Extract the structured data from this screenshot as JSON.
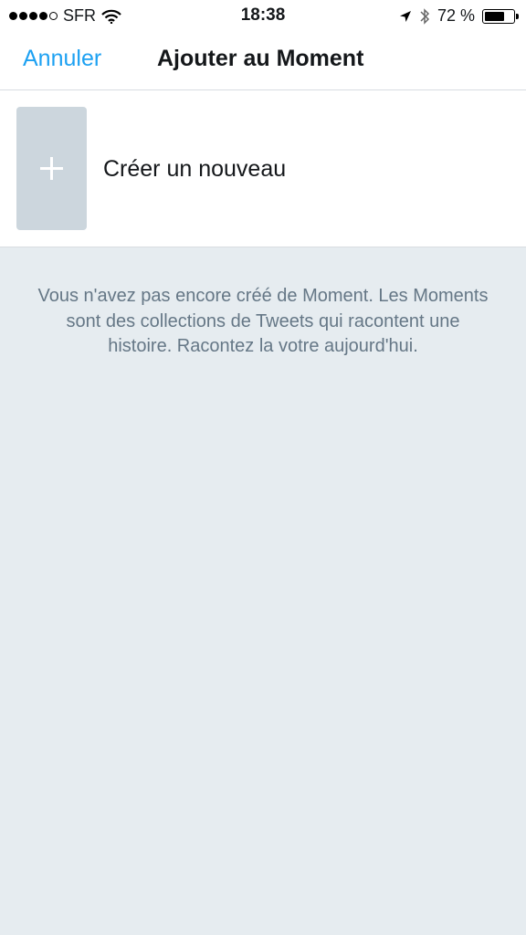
{
  "status_bar": {
    "carrier": "SFR",
    "time": "18:38",
    "battery_percent_label": "72 %",
    "battery_level": 0.72,
    "signal_bars_filled": 4,
    "signal_bars_total": 5
  },
  "nav": {
    "cancel_label": "Annuler",
    "title": "Ajouter au Moment"
  },
  "create": {
    "label": "Créer un nouveau"
  },
  "empty_state": {
    "message": "Vous n'avez pas encore créé de Moment. Les Moments sont des collections de Tweets qui racontent une histoire. Racontez la votre aujourd'hui."
  },
  "colors": {
    "accent": "#1da1f2",
    "background": "#e6ecf0",
    "tile": "#ccd6dd",
    "secondary_text": "#657786"
  },
  "icons": [
    "signal-dots-icon",
    "wifi-icon",
    "location-arrow-icon",
    "bluetooth-icon",
    "battery-icon",
    "plus-icon"
  ]
}
